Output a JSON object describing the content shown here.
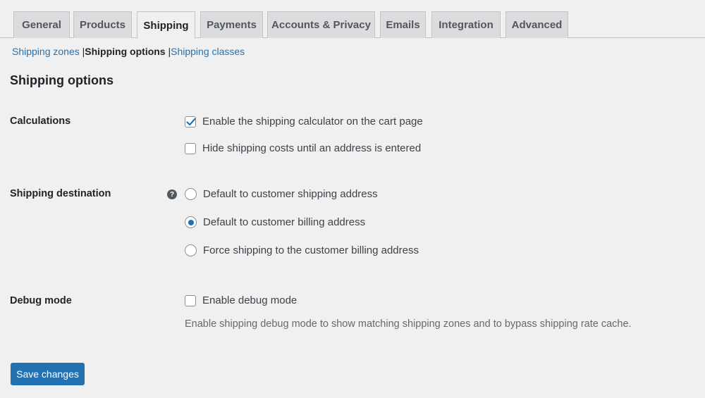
{
  "tabs": [
    {
      "label": "General"
    },
    {
      "label": "Products"
    },
    {
      "label": "Shipping",
      "active": true
    },
    {
      "label": "Payments"
    },
    {
      "label": "Accounts & Privacy"
    },
    {
      "label": "Emails"
    },
    {
      "label": "Integration"
    },
    {
      "label": "Advanced"
    }
  ],
  "subnav": {
    "zones": "Shipping zones",
    "options": "Shipping options",
    "classes": "Shipping classes",
    "separator": "|"
  },
  "section_title": "Shipping options",
  "calculations": {
    "label": "Calculations",
    "options": [
      {
        "label": "Enable the shipping calculator on the cart page",
        "checked": true
      },
      {
        "label": "Hide shipping costs until an address is entered",
        "checked": false
      }
    ]
  },
  "destination": {
    "label": "Shipping destination",
    "help": "?",
    "options": [
      {
        "label": "Default to customer shipping address",
        "selected": false
      },
      {
        "label": "Default to customer billing address",
        "selected": true
      },
      {
        "label": "Force shipping to the customer billing address",
        "selected": false
      }
    ]
  },
  "debug": {
    "label": "Debug mode",
    "option": {
      "label": "Enable debug mode",
      "checked": false
    },
    "description": "Enable shipping debug mode to show matching shipping zones and to bypass shipping rate cache."
  },
  "save_label": "Save changes",
  "colors": {
    "accent": "#2271b1",
    "background": "#f0f0f1"
  }
}
